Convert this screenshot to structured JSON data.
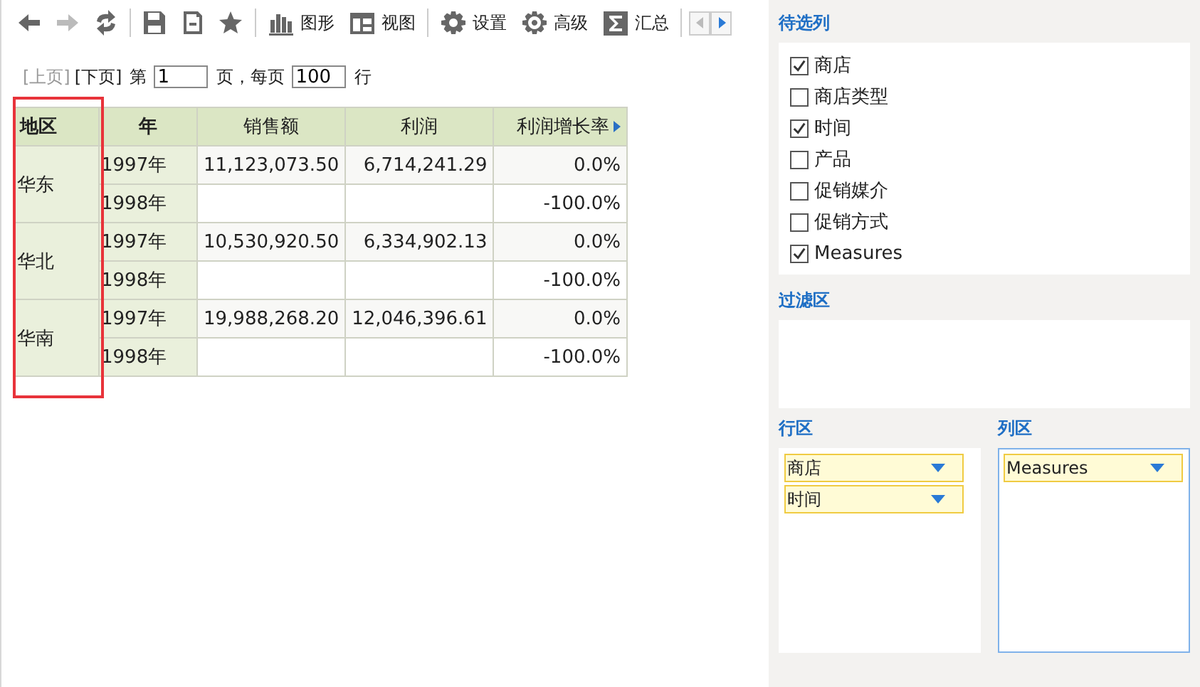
{
  "toolbar": [
    {
      "kind": "back",
      "disabled": false
    },
    {
      "kind": "forward",
      "disabled": true
    },
    {
      "kind": "refresh",
      "disabled": false
    },
    {
      "kind": "separator"
    },
    {
      "kind": "save",
      "disabled": false
    },
    {
      "kind": "save-as",
      "disabled": false
    },
    {
      "kind": "star",
      "disabled": false
    },
    {
      "kind": "separator"
    },
    {
      "kind": "chart",
      "label": "图形",
      "disabled": false
    },
    {
      "kind": "view",
      "label": "视图",
      "disabled": false
    },
    {
      "kind": "separator"
    },
    {
      "kind": "settings",
      "label": "设置",
      "disabled": false
    },
    {
      "kind": "advanced",
      "label": "高级",
      "disabled": false
    },
    {
      "kind": "sum",
      "label": "汇总",
      "disabled": false
    }
  ],
  "pager": {
    "prev": {
      "label": "[上页]",
      "disabled": true
    },
    "next": {
      "label": "[下页]",
      "disabled": false
    },
    "page_prefix": "第",
    "page": "1",
    "page_suffix": "页，每页",
    "page_size": "100",
    "size_suffix": "行"
  },
  "table": {
    "columns": [
      "地区",
      "年",
      "销售额",
      "利润",
      "利润增长率"
    ],
    "groups": [
      {
        "region": "华东",
        "rows": [
          [
            "1997年",
            "11,123,073.50",
            "6,714,241.29",
            "0.0%"
          ],
          [
            "1998年",
            "",
            "",
            "-100.0%"
          ]
        ]
      },
      {
        "region": "华北",
        "rows": [
          [
            "1997年",
            "10,530,920.50",
            "6,334,902.13",
            "0.0%"
          ],
          [
            "1998年",
            "",
            "",
            "-100.0%"
          ]
        ]
      },
      {
        "region": "华南",
        "rows": [
          [
            "1997年",
            "19,988,268.20",
            "12,046,396.61",
            "0.0%"
          ],
          [
            "1998年",
            "",
            "",
            "-100.0%"
          ]
        ]
      }
    ]
  },
  "candidate_columns": {
    "title": "待选列",
    "items": [
      {
        "label": "商店",
        "checked": true
      },
      {
        "label": "商店类型",
        "checked": false
      },
      {
        "label": "时间",
        "checked": true
      },
      {
        "label": "产品",
        "checked": false
      },
      {
        "label": "促销媒介",
        "checked": false
      },
      {
        "label": "促销方式",
        "checked": false
      },
      {
        "label": "Measures",
        "checked": true
      }
    ]
  },
  "filter_area": {
    "title": "过滤区"
  },
  "row_area": {
    "title": "行区",
    "focused": false,
    "items": [
      "商店",
      "时间"
    ]
  },
  "column_area": {
    "title": "列区",
    "focused": true,
    "items": [
      "Measures"
    ]
  }
}
